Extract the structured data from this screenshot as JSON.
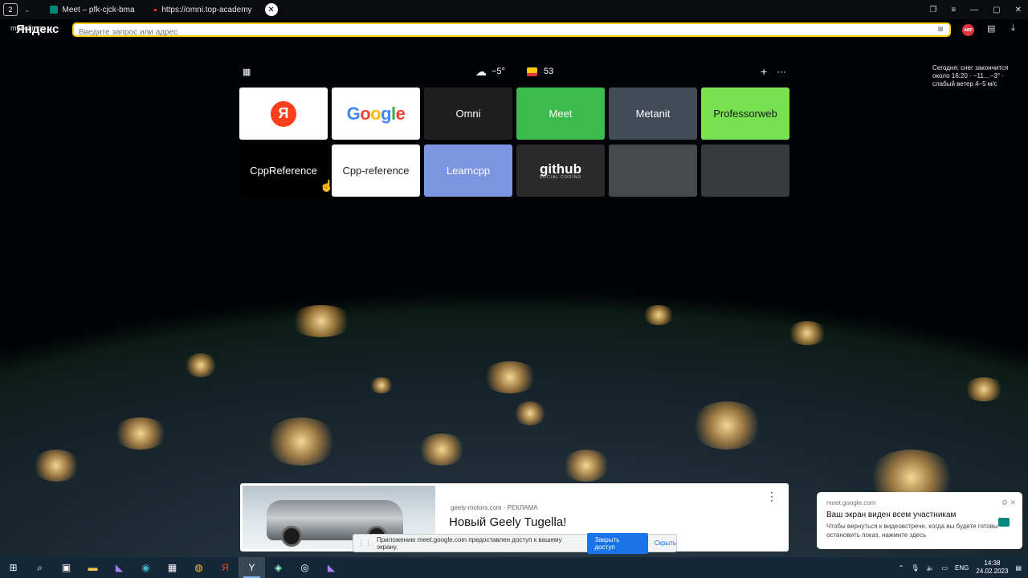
{
  "browser": {
    "tab_count": "2",
    "tabs": [
      {
        "title": "Meet – pfk-cjck-bma",
        "favicon_color": "#00897b"
      },
      {
        "title": "https://omni.top-academy",
        "favicon_color": "#e2343c"
      }
    ],
    "brand": "Яндекс",
    "user": "maxefimov",
    "address_placeholder": "Введите запрос или адрес",
    "abp_label": "ABP"
  },
  "dashboard": {
    "temperature": "−5°",
    "mail_count": "53",
    "weather_note": "Сегодня: снег закончится около 16:20 · −11…−3° · слабый ветер 4–5 м/с"
  },
  "tiles": [
    {
      "label": "Я",
      "kind": "yandex",
      "bg": "#ffffff"
    },
    {
      "label": "Google",
      "kind": "google",
      "bg": "#ffffff"
    },
    {
      "label": "Omni",
      "kind": "text",
      "bg": "#1f1f1f"
    },
    {
      "label": "Meet",
      "kind": "text",
      "bg": "#3dba4e"
    },
    {
      "label": "Metanit",
      "kind": "text",
      "bg": "#424c58"
    },
    {
      "label": "Professorweb",
      "kind": "text",
      "bg": "#77e151",
      "fg": "#1a1a1a"
    },
    {
      "label": "CppReference",
      "kind": "text",
      "bg": "#000000"
    },
    {
      "label": "Cpp-reference",
      "kind": "text",
      "bg": "#ffffff",
      "fg": "#222222"
    },
    {
      "label": "Learncpp",
      "kind": "text",
      "bg": "#7b95e0"
    },
    {
      "label": "github",
      "sub": "SOCIAL CODING",
      "kind": "github",
      "bg": "#2b2b2b"
    },
    {
      "label": "",
      "kind": "empty",
      "bg": "rgba(255,255,255,0.28)"
    },
    {
      "label": "",
      "kind": "empty",
      "bg": "rgba(255,255,255,0.22)"
    }
  ],
  "ad": {
    "source": "geely-motors.com · РЕКЛАМА",
    "title": "Новый Geely Tugella!"
  },
  "share_bar": {
    "message": "Приложению meet.google.com предоставлен доступ к вашему экрану.",
    "stop_label": "Закрыть доступ",
    "hide_label": "Скрыть"
  },
  "notification": {
    "source": "meet.google.com",
    "title": "Ваш экран виден всем участникам",
    "body": "Чтобы вернуться к видеовстрече, когда вы будете готовы остановить показ, нажмите здесь"
  },
  "taskbar": {
    "language": "ENG",
    "time": "14:38",
    "date": "24.02.2023"
  }
}
